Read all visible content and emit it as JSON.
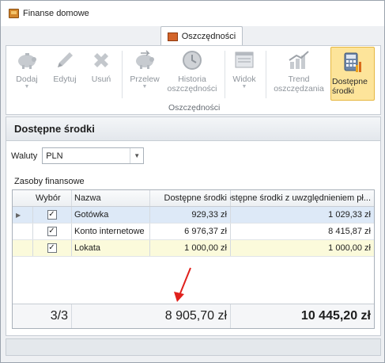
{
  "window": {
    "title": "Finanse domowe"
  },
  "ribbon": {
    "active_tab": "Oszczędności",
    "buttons": [
      {
        "label": "Dodaj",
        "icon": "piggy-bank-icon",
        "has_dropdown": true
      },
      {
        "label": "Edytuj",
        "icon": "pencil-icon"
      },
      {
        "label": "Usuń",
        "icon": "delete-x-icon"
      },
      {
        "label": "Przelew",
        "icon": "piggy-transfer-icon",
        "has_dropdown": true
      },
      {
        "label": "Historia oszczędności",
        "icon": "clock-history-icon"
      },
      {
        "label": "Widok",
        "icon": "window-view-icon",
        "has_dropdown": true
      },
      {
        "label": "Trend oszczędzania",
        "icon": "trend-chart-icon"
      },
      {
        "label": "Dostępne środki",
        "icon": "calculator-chart-icon",
        "active": true
      }
    ],
    "group_label": "Oszczędności"
  },
  "panel": {
    "title": "Dostępne środki",
    "currency_label": "Waluty",
    "currency_value": "PLN",
    "section_label": "Zasoby finansowe"
  },
  "grid": {
    "columns": [
      "Wybór",
      "Nazwa",
      "Dostępne środki",
      "Dostępne środki z uwzględnieniem pł..."
    ],
    "rows": [
      {
        "checked": true,
        "name": "Gotówka",
        "available": "929,33 zł",
        "available_incl": "1 029,33 zł"
      },
      {
        "checked": true,
        "name": "Konto internetowe",
        "available": "6 976,37 zł",
        "available_incl": "8 415,87 zł"
      },
      {
        "checked": true,
        "name": "Lokata",
        "available": "1 000,00 zł",
        "available_incl": "1 000,00 zł"
      }
    ],
    "footer": {
      "count": "3/3",
      "total_available": "8 905,70 zł",
      "total_incl": "10 445,20 zł"
    }
  },
  "colors": {
    "active_button_bg": "#fde49a",
    "arrow": "#e0201c",
    "selected_row": "#dde9f7",
    "alt_row": "#fbfadb"
  }
}
